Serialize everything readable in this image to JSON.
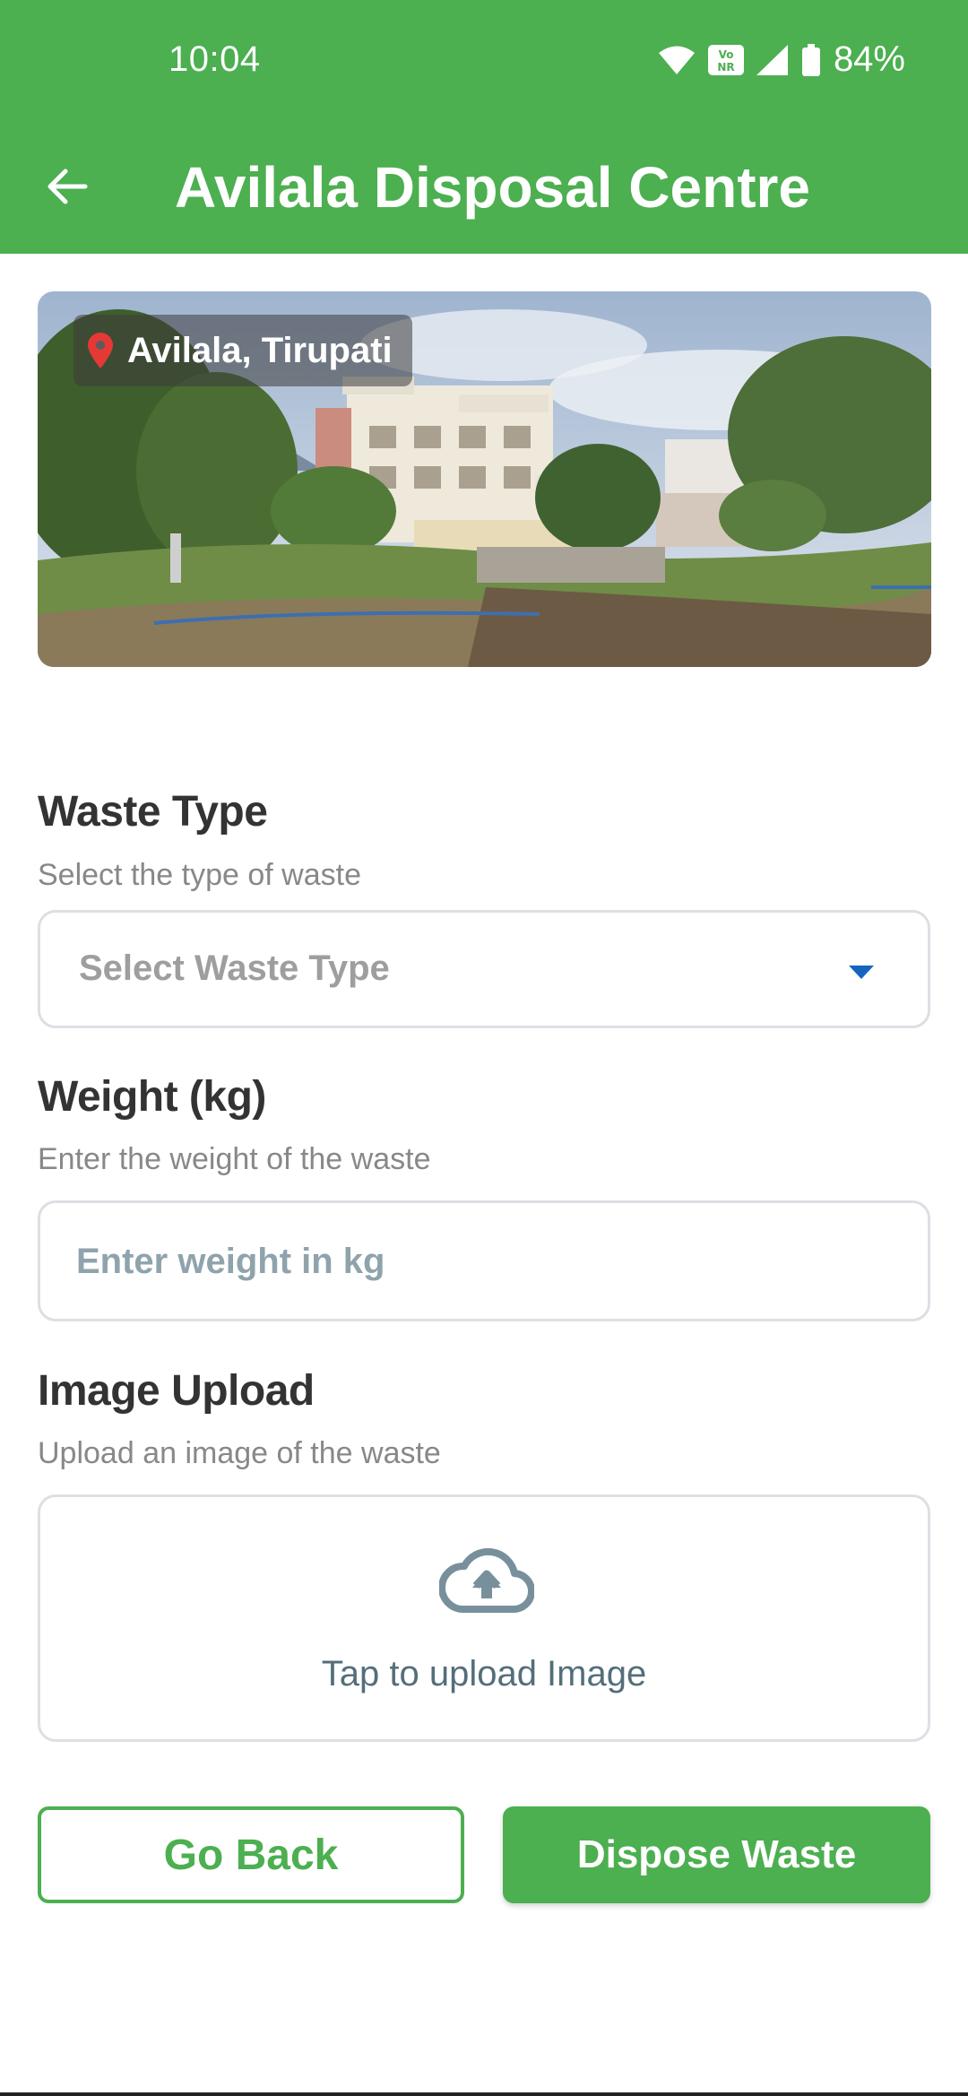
{
  "status_bar": {
    "time": "10:04",
    "battery": "84%",
    "icons": [
      "wifi-icon",
      "vonr-icon",
      "signal-icon",
      "battery-icon"
    ]
  },
  "app_bar": {
    "title": "Avilala Disposal Centre",
    "back_icon": "arrow-left-icon"
  },
  "hero": {
    "location": "Avilala, Tirupati",
    "pin_icon": "location-pin-icon"
  },
  "form": {
    "waste_type": {
      "label": "Waste Type",
      "hint": "Select the type of waste",
      "selected": "Select Waste Type"
    },
    "weight": {
      "label": "Weight (kg)",
      "hint": "Enter the weight of the waste",
      "placeholder": "Enter weight in kg",
      "value": ""
    },
    "image": {
      "label": "Image Upload",
      "hint": "Upload an image of the waste",
      "cta": "Tap to upload Image",
      "icon": "cloud-upload-icon"
    }
  },
  "actions": {
    "back": "Go Back",
    "dispose": "Dispose Waste"
  },
  "colors": {
    "primary": "#4caf50",
    "pin": "#e53935",
    "caret": "#1565c0"
  }
}
